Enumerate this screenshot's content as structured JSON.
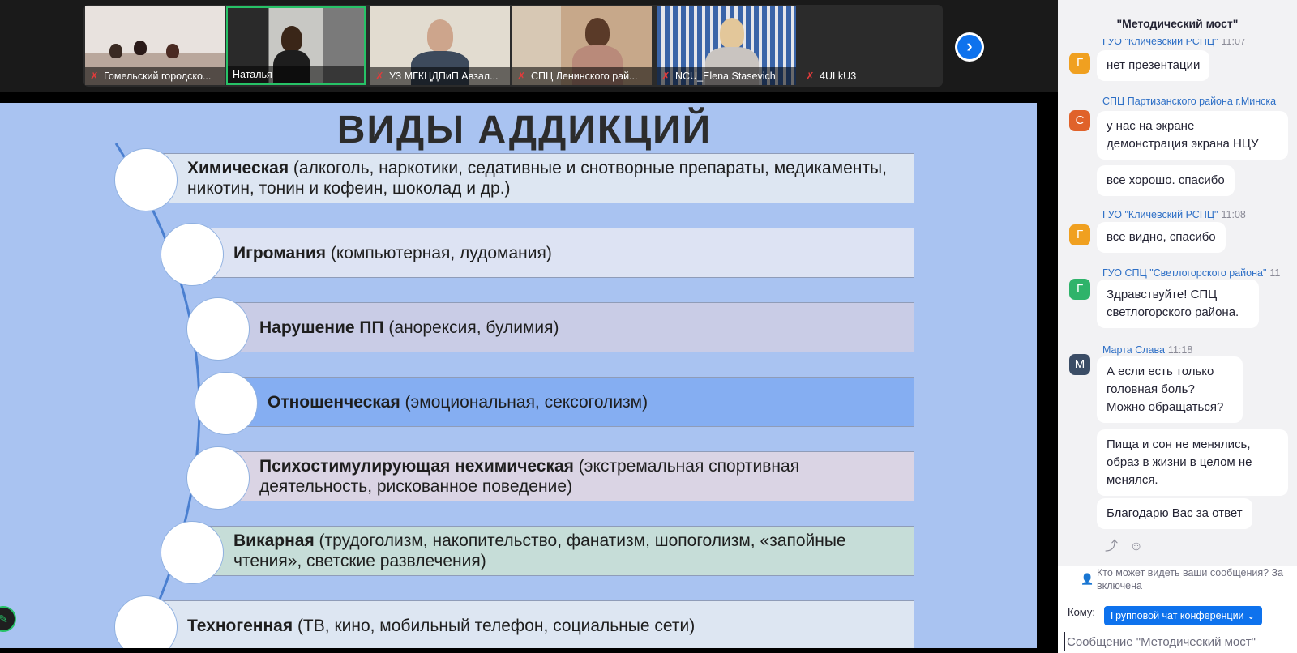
{
  "participants": [
    {
      "name": "Гомельский городско...",
      "muted": true
    },
    {
      "name": "Наталья",
      "muted": false,
      "active": true
    },
    {
      "name": "УЗ МГКЦДПиП Авзал...",
      "muted": true
    },
    {
      "name": "СПЦ Ленинского рай...",
      "muted": true
    },
    {
      "name": "NCU_Elena Stasevich",
      "muted": true
    },
    {
      "name": "4ULkU3",
      "muted": true
    }
  ],
  "next_icon": "chevron-right-icon",
  "slide": {
    "title": "ВИДЫ АДДИКЦИЙ",
    "rows": [
      {
        "bold": "Химическая",
        "rest": " (алкоголь, наркотики, седативные и  снотворные препараты, медикаменты, никотин, тонин и  кофеин, шоколад и др.)",
        "color": "#dde6f2"
      },
      {
        "bold": "Игромания",
        "rest": " (компьютерная, лудомания)",
        "color": "#dde3f3"
      },
      {
        "bold": "Нарушение ПП",
        "rest": " (анорексия, булимия)",
        "color": "#c9cce6"
      },
      {
        "bold": "Отношенческая",
        "rest": " (эмоциональная, сексоголизм)",
        "color": "#85aef2"
      },
      {
        "bold": "Психостимулирующая нехимическая",
        "rest": " (экстремальная спортивная деятельность, рискованное поведение)",
        "color": "#dad4e4"
      },
      {
        "bold": "Викарная",
        "rest": "  (трудоголизм, накопительство, фанатизм, шопоголизм, «запойные чтения», светские развлечения)",
        "color": "#c6ddd8"
      },
      {
        "bold": "Техногенная",
        "rest": " (ТВ, кино, мобильный телефон, социальные сети)",
        "color": "#dde6f2"
      }
    ]
  },
  "chat": {
    "title": "\"Методический мост\"",
    "messages": [
      {
        "sender": "ГУО \"Кличевский РСПЦ\"",
        "time": "11:07",
        "avatar": "Г",
        "avatar_color": "#f0a020",
        "texts": [
          "нет презентации"
        ]
      },
      {
        "sender": "СПЦ Партизанского района г.Минска",
        "time": "",
        "avatar": "С",
        "avatar_color": "#e0622a",
        "texts": [
          "у нас на экране демонстрация экрана НЦУ",
          "все хорошо. спасибо"
        ]
      },
      {
        "sender": "ГУО \"Кличевский РСПЦ\"",
        "time": "11:08",
        "avatar": "Г",
        "avatar_color": "#f0a020",
        "texts": [
          "все видно, спасибо"
        ]
      },
      {
        "sender": "ГУО СПЦ \"Светлогорского района\"",
        "time": "11",
        "avatar": "Г",
        "avatar_color": "#2fb36a",
        "texts": [
          "Здравствуйте! СПЦ светлогорского района."
        ]
      },
      {
        "sender": "Марта Слава",
        "time": "11:18",
        "avatar": "М",
        "avatar_color": "#3b4d66",
        "texts": [
          "А если есть только головная боль? Можно обращаться?",
          "Пища и сон не менялись, образ в жизни в целом не менялся.",
          "Благодарю Вас за ответ"
        ]
      }
    ],
    "privacy_line1": "Кто может видеть ваши сообщения? За",
    "privacy_line2": "включена",
    "to_label": "Кому:",
    "to_value": "Групповой чат конференции",
    "input_placeholder": "Сообщение \"Методический мост\""
  }
}
